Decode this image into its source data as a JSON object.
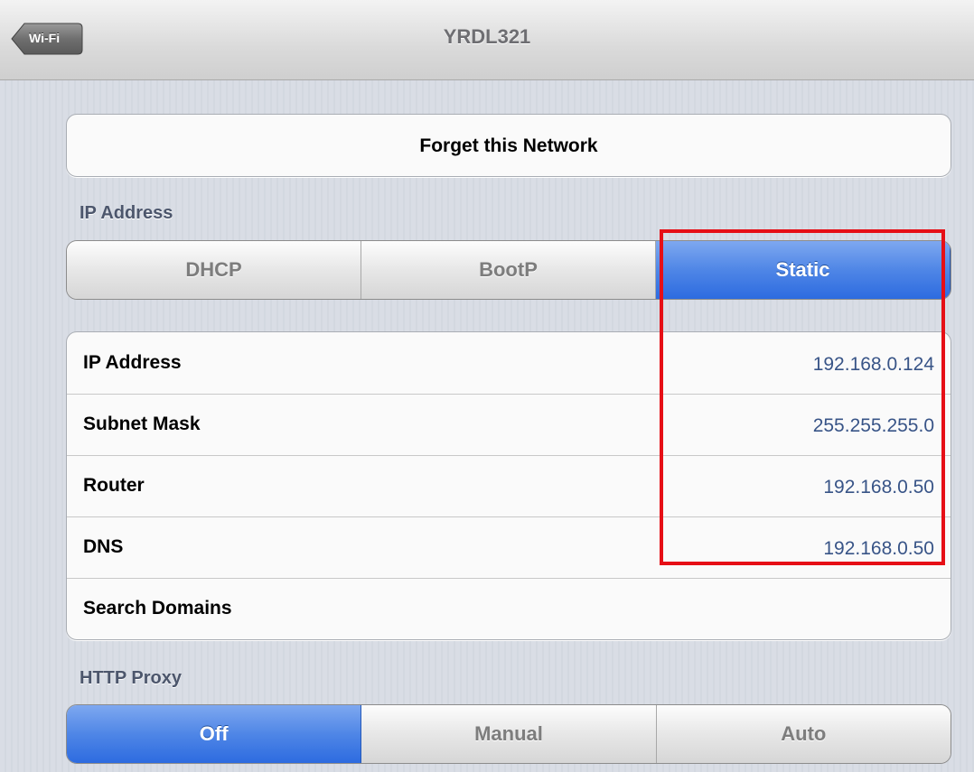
{
  "navbar": {
    "back_label": "Wi-Fi",
    "title": "YRDL321"
  },
  "forget_button": {
    "label": "Forget this Network"
  },
  "ip_section": {
    "header": "IP Address",
    "modes": [
      {
        "label": "DHCP",
        "selected": false
      },
      {
        "label": "BootP",
        "selected": false
      },
      {
        "label": "Static",
        "selected": true
      }
    ]
  },
  "static_fields": [
    {
      "label": "IP Address",
      "value": "192.168.0.124"
    },
    {
      "label": "Subnet Mask",
      "value": "255.255.255.0"
    },
    {
      "label": "Router",
      "value": "192.168.0.50"
    },
    {
      "label": "DNS",
      "value": "192.168.0.50"
    },
    {
      "label": "Search Domains",
      "value": ""
    }
  ],
  "proxy_section": {
    "header": "HTTP Proxy",
    "modes": [
      {
        "label": "Off",
        "selected": true
      },
      {
        "label": "Manual",
        "selected": false
      },
      {
        "label": "Auto",
        "selected": false
      }
    ]
  },
  "colors": {
    "active_segment": "#4f86e6",
    "value_text": "#385487",
    "annotation_box": "#e60f16"
  },
  "icons": {
    "back": "back-arrow-icon"
  }
}
